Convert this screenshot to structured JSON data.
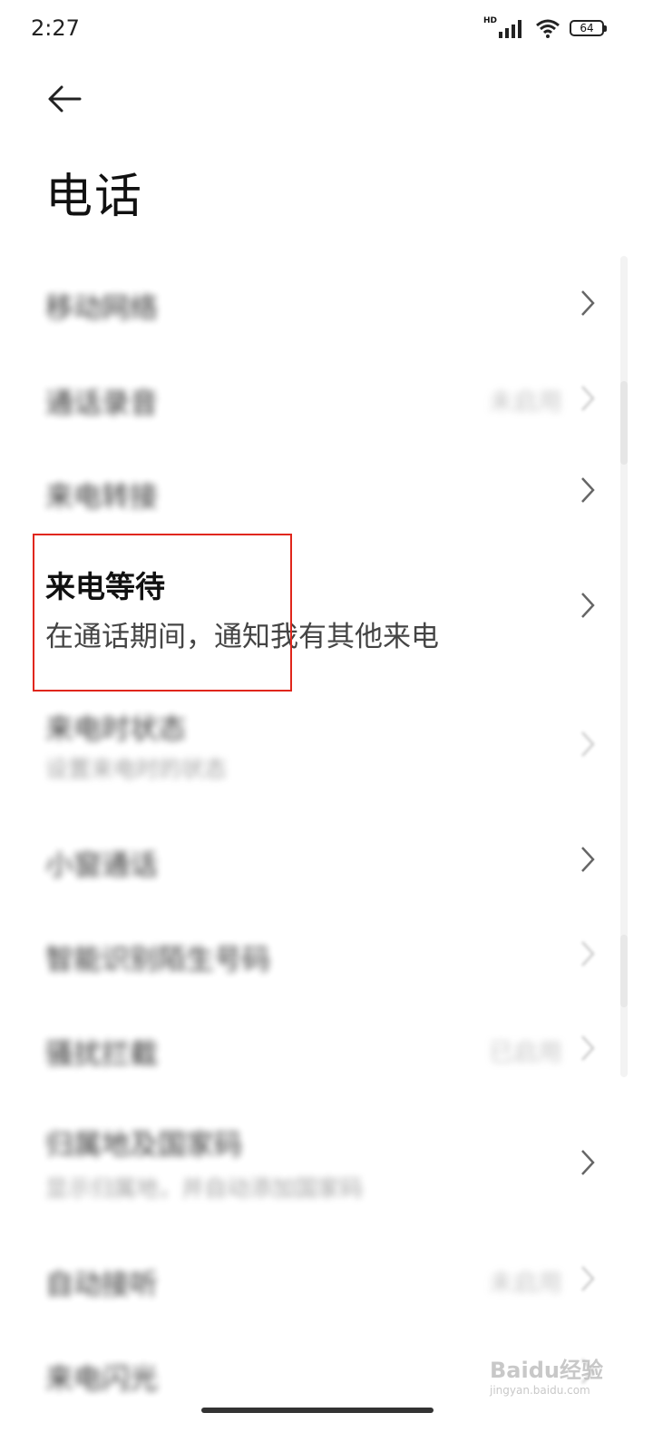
{
  "status_bar": {
    "time": "2:27",
    "network": "HD",
    "battery": "64"
  },
  "header": {
    "title": "电话"
  },
  "items": [
    {
      "title": "移动网络",
      "value": "",
      "subtitle": ""
    },
    {
      "title": "通话录音",
      "value": "未启用",
      "subtitle": ""
    },
    {
      "title": "来电转接",
      "value": "",
      "subtitle": ""
    },
    {
      "title": "来电等待",
      "value": "",
      "subtitle": "在通话期间，通知我有其他来电"
    },
    {
      "title": "来电时状态",
      "value": "",
      "subtitle": "设置来电时的状态"
    },
    {
      "title": "小窗通话",
      "value": "",
      "subtitle": ""
    },
    {
      "title": "智能识别陌生号码",
      "value": "",
      "subtitle": ""
    },
    {
      "title": "骚扰拦截",
      "value": "已启用",
      "subtitle": ""
    },
    {
      "title": "归属地及国家码",
      "value": "",
      "subtitle": "显示归属地，并自动添加国家码"
    },
    {
      "title": "自动接听",
      "value": "未启用",
      "subtitle": ""
    },
    {
      "title": "来电闪光",
      "value": "",
      "subtitle": ""
    }
  ],
  "watermark": {
    "brand": "Baidu经验",
    "url": "jingyan.baidu.com"
  },
  "icons": {
    "back": "arrow-left-icon",
    "chevron": "chevron-right-icon",
    "signal": "signal-icon",
    "wifi": "wifi-icon",
    "battery": "battery-icon"
  },
  "colors": {
    "highlight": "#e0261b",
    "background": "#ffffff",
    "text": "#111111"
  }
}
